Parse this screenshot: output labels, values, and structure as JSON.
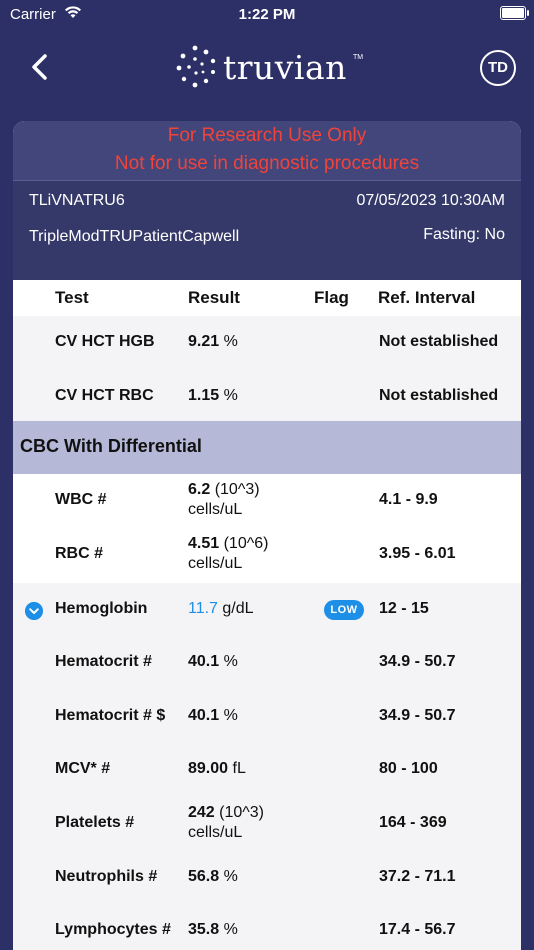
{
  "status_bar": {
    "carrier": "Carrier",
    "time": "1:22 PM"
  },
  "header": {
    "logo_text": "truvian",
    "trademark": "TM",
    "avatar_initials": "TD"
  },
  "banner": {
    "line1": "For Research Use Only",
    "line2": "Not for use in diagnostic procedures",
    "color": "#f0433a"
  },
  "meta": {
    "sample_id": "TLiVNATRU6",
    "datetime": "07/05/2023 10:30AM",
    "patient": "TripleModTRUPatientCapwell",
    "fasting": "Fasting: No"
  },
  "table": {
    "headers": {
      "test": "Test",
      "result": "Result",
      "flag": "Flag",
      "ref": "Ref. Interval"
    },
    "top_rows": [
      {
        "test": "CV HCT HGB",
        "value": "9.21",
        "unit": " %",
        "unit2": "",
        "ref": "Not established"
      },
      {
        "test": "CV HCT RBC",
        "value": "1.15",
        "unit": " %",
        "unit2": "",
        "ref": "Not established"
      }
    ],
    "section_title": "CBC With Differential",
    "rows": [
      {
        "test": "WBC #",
        "value": "6.2",
        "unit": " (10^3)",
        "unit2": "cells/uL",
        "ref": "4.1 - 9.9"
      },
      {
        "test": "RBC #",
        "value": "4.51",
        "unit": " (10^6)",
        "unit2": "cells/uL",
        "ref": "3.95 - 6.01"
      },
      {
        "test": "Hemoglobin",
        "value": "11.7",
        "unit": " g/dL",
        "unit2": "",
        "ref": "12 - 15",
        "flag": "LOW"
      },
      {
        "test": "Hematocrit #",
        "value": "40.1",
        "unit": " %",
        "unit2": "",
        "ref": "34.9 - 50.7"
      },
      {
        "test": "Hematocrit # $",
        "value": "40.1",
        "unit": " %",
        "unit2": "",
        "ref": "34.9 - 50.7"
      },
      {
        "test": "MCV* #",
        "value": "89.00",
        "unit": " fL",
        "unit2": "",
        "ref": "80 - 100"
      },
      {
        "test": "Platelets #",
        "value": "242",
        "unit": " (10^3)",
        "unit2": "cells/uL",
        "ref": "164 - 369"
      },
      {
        "test": "Neutrophils #",
        "value": "56.8",
        "unit": " %",
        "unit2": "",
        "ref": "37.2 - 71.1"
      },
      {
        "test": "Lymphocytes #",
        "value": "35.8",
        "unit": " %",
        "unit2": "",
        "ref": "17.4 - 56.7"
      }
    ]
  },
  "colors": {
    "background": "#2d3066",
    "section": "#b6b8d8",
    "accent": "#1e8fe6"
  }
}
